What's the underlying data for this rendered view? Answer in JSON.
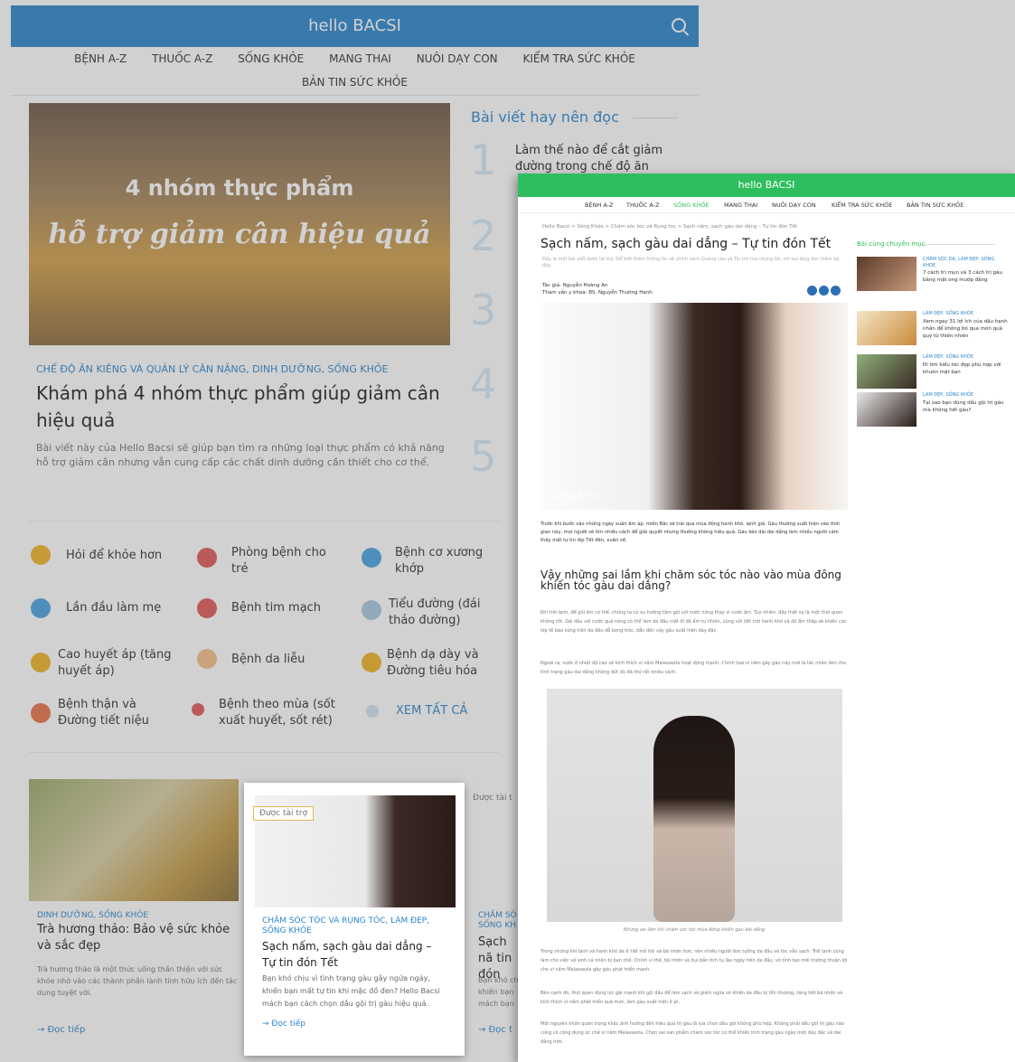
{
  "bg": {
    "logo": "hello BACSI",
    "nav_row1": [
      "BỆNH A-Z",
      "THUỐC A-Z",
      "SỐNG KHỎE",
      "MANG THAI",
      "NUÔI DẠY CON",
      "KIỂM TRA SỨC KHỎE"
    ],
    "nav_row2": [
      "BẢN TIN SỨC KHỎE"
    ],
    "hero_text1": "4 nhóm thực phẩm",
    "hero_text2": "hỗ trợ giảm cân hiệu quả",
    "hero_category": "CHẾ ĐỘ ĂN KIÊNG VÀ QUẢN LÝ CÂN NẶNG, DINH DƯỠNG, SỐNG KHỎE",
    "hero_title": "Khám phá 4 nhóm thực phẩm giúp giảm cân hiệu quả",
    "hero_desc": "Bài viết này của Hello Bacsi sẽ giúp bạn tìm ra những loại thực phẩm có khả năng hỗ trợ giảm cân nhưng vẫn cung cấp các chất dinh dưỡng cần thiết cho cơ thể.",
    "side_title": "Bài viết hay nên đọc",
    "side_item1": "Làm thế nào để cắt giảm đường trong chế độ ăn",
    "side_numbers": [
      "1",
      "2",
      "3",
      "4",
      "5"
    ],
    "health": [
      "Hỏi để khỏe hơn",
      "Phòng bệnh cho trẻ",
      "Bệnh cơ xương khớp",
      "Lần đầu làm mẹ",
      "Bệnh tim mạch",
      "Tiểu đường (đái tháo đường)",
      "Cao huyết áp (tăng huyết áp)",
      "Bệnh da liễu",
      "Bệnh dạ dày và Đường tiêu hóa",
      "Bệnh thận và Đường tiết niệu",
      "Bệnh theo mùa (sốt xuất huyết, sốt rét)",
      "XEM TẤT CẢ"
    ],
    "card1": {
      "category": "DINH DƯỠNG, SỐNG KHỎE",
      "title": "Trà hương thảo: Bảo vệ sức khỏe và sắc đẹp",
      "desc": "Trà hương thảo là một thức uống thần thiện với sức khỏe nhờ vào các thành phần lành tính hữu ích đến tác dụng tuyệt vời.",
      "more": "→ Đọc tiếp"
    },
    "card3": {
      "badge": "Được tài t",
      "category": "CHĂM SÓ SỐNG KH",
      "title": "Sạch nã tin đón",
      "desc": "Bạn khó ch khiến bạn mách bạn",
      "more": "→ Đọc t"
    }
  },
  "featured_card": {
    "badge": "Được tài trợ",
    "category": "CHĂM SÓC TÓC VÀ RỤNG TÓC, LÀM ĐẸP, SỐNG KHỎE",
    "title": "Sạch nấm, sạch gàu dai dẳng – Tự tin đón Tết",
    "desc": "Bạn khó chịu vì tình trạng gàu gây ngứa ngáy, khiến bạn mất tự tin khi mặc đồ đen? Hello Bacsi mách bạn cách chọn dầu gội trị gàu hiệu quả.",
    "more": "→ Đọc tiếp"
  },
  "article": {
    "logo": "hello BACSI",
    "header_color": "#2fbe5e",
    "nav": [
      "BỆNH A-Z",
      "THUỐC A-Z",
      "SỐNG KHỎE",
      "MANG THAI",
      "NUÔI DẠY CON",
      "KIỂM TRA SỨC KHỎE",
      "BẢN TIN SỨC KHỎE"
    ],
    "breadcrumb": "Hello Bacsi > Sống Khỏe > Chăm sóc tóc và Rụng tóc > Sạch nấm, sạch gàu dai dẳng – Tự tin đón Tết",
    "title": "Sạch nấm, sạch gàu dai dẳng – Tự tin đón Tết",
    "subtitle": "Đây là một bài viết được tài trợ. Để biết thêm thông tin về chính sách Quảng cáo và Tài trợ của chúng tôi, xin vui lòng đọc thêm tại đây.",
    "author": "Tác giả: Nguyễn Hoàng An",
    "reviewer": "Tham vấn y khoa: BS. Nguyễn Thường Hanh",
    "image_watermark": "helloBACSI",
    "intro": "Trước khi bước vào những ngày xuân ấm áp, miền Bắc sẽ trải qua mùa đông hanh khô, lạnh giá. Gàu thường xuất hiện vào thời gian này, mọi người sẽ tìm nhiều cách để giải quyết nhưng thường không hiệu quả. Gàu kéo dài dai dẳng làm nhiều người cảm thấy mất tự tin dịp Tết đến, xuân về.",
    "h2": "Vậy những sai lầm khi chăm sóc tóc nào vào mùa đông khiến tóc gàu dai dẳng?",
    "p2": "Khi trời lạnh, để giữ ấm cơ thể, chúng ta có xu hướng tắm gội với nước nóng thay vì nước ấm. Tuy nhiên, đây thật sự là một thói quen không tốt. Gội đầu với nước quá nóng có thể làm da đầu mất đi độ ẩm tự nhiên, cùng với tiết trời hanh khô và độ ẩm thấp sẽ khiến các lớp tế bào sừng trên da đầu dễ bong tróc, dẫn đến vảy gàu xuất hiện dày đặc.",
    "p3": "Ngoài ra, nước ở nhiệt độ cao sẽ kích thích vi nấm Malassezia hoạt động mạnh. Chính loại vi nấm gây gàu này mới là tác nhân làm cho tình trạng gàu dai dẳng không dứt dù đã thử rất nhiều cách.",
    "caption": "Những sai lầm khi chăm sóc tóc mùa đông khiến gàu dai dẳng",
    "p4": "Trong những khi lạnh và hanh khô da ít tiết mồ hôi và bã nhờn hơn, nên nhiều người làm tưởng da đầu và tóc vẫn sạch. Trời lạnh cũng làm cho việc vệ sinh cá nhân bị bạn chế. Chính vì thế, bã nhờn và bụi bẩn tích tụ lâu ngày trên da đầu, vô tình tạo môi trường thuận lợi cho vi nấm Malassezia gây gàu phát triển mạnh.",
    "p5": "Bên cạnh đó, thói quen dùng lực gãi mạnh khi gội đầu để làm sạch và giảm ngứa sẽ khiến da đầu bị tổn thương, tăng tiết bã nhờn và kích thích vi nấm phát triển quá mức, làm gàu xuất hiện ồ ạt.",
    "p6": "Một nguyên nhân quan trọng khác ảnh hưởng đến hiệu quả trị gàu là lựa chọn dầu gội không phù hợp. Không phải dầu gội trị gàu nào cũng có công dụng ức chế vi nấm Malassezia. Chọn sai sản phẩm chăm sóc tóc có thể khiến tình trạng gàu ngày một dày đặc và dai dẳng hơn.",
    "side_heading": "Bài cùng chuyên mục",
    "side_items": [
      {
        "category": "CHĂM SÓC DA, LÀM ĐẸP, SỐNG KHỎE",
        "title": "7 cách trị mụn và 3 cách trị gàu bằng mật ong mướp đắng"
      },
      {
        "category": "LÀM ĐẸP, SỐNG KHỎE",
        "title": "Xem ngay 31 lợi ích của dầu hạnh nhân để không bỏ qua món quà quý từ thiên nhiên"
      },
      {
        "category": "LÀM ĐẸP, SỐNG KHỎE",
        "title": "Đi tìm kiểu tóc đẹp phù hợp với khuôn mặt bạn"
      },
      {
        "category": "LÀM ĐẸP, SỐNG KHỎE",
        "title": "Tại sao bạn dùng dầu gội trị gàu mà không hết gàu?"
      }
    ]
  }
}
